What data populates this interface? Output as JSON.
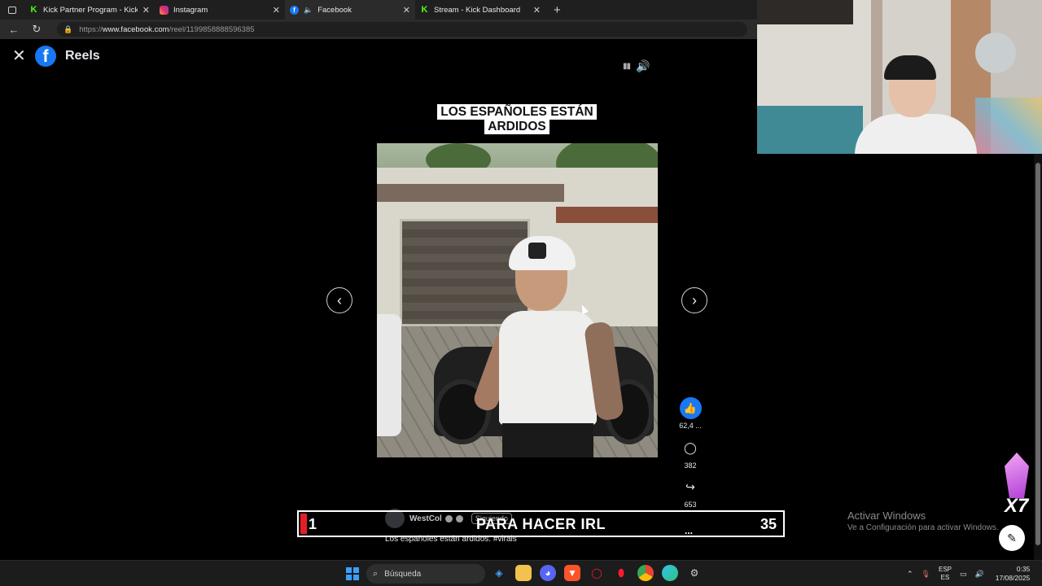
{
  "browser": {
    "tabs": [
      {
        "title": "Kick Partner Program - Kick Dash",
        "favicon": "kick-icon",
        "active": false
      },
      {
        "title": "Instagram",
        "favicon": "instagram-icon",
        "active": false
      },
      {
        "title": "Facebook",
        "favicon": "facebook-icon",
        "active": true
      },
      {
        "title": "Stream - Kick Dashboard",
        "favicon": "kick-icon",
        "active": false
      }
    ],
    "url_prefix": "https://",
    "url_host": "www.facebook.com",
    "url_path": "/reel/1199858888596385"
  },
  "reels": {
    "title": "Reels",
    "caption": "LOS ESPAÑOLES ESTÁN ARDIDOS",
    "likes": "62,4 ...",
    "comments": "382",
    "shares": "653",
    "author": "WestCol",
    "follow_label": "Siguiendo",
    "description": "Los españoles están ardidos. #virals",
    "more": "..."
  },
  "overlay": {
    "left_number": "1",
    "center_text": "PARA HACER IRL",
    "right_number": "35"
  },
  "windows": {
    "activate_title": "Activar Windows",
    "activate_sub": "Ve a Configuración para activar Windows.",
    "badge_text": "X7"
  },
  "taskbar": {
    "search_placeholder": "Búsqueda",
    "lang_top": "ESP",
    "lang_bottom": "ES",
    "time": "0:35",
    "date": "17/08/2025"
  },
  "colors": {
    "facebook_blue": "#1877f2",
    "kick_green": "#53fc18",
    "overlay_red": "#e41e26"
  }
}
